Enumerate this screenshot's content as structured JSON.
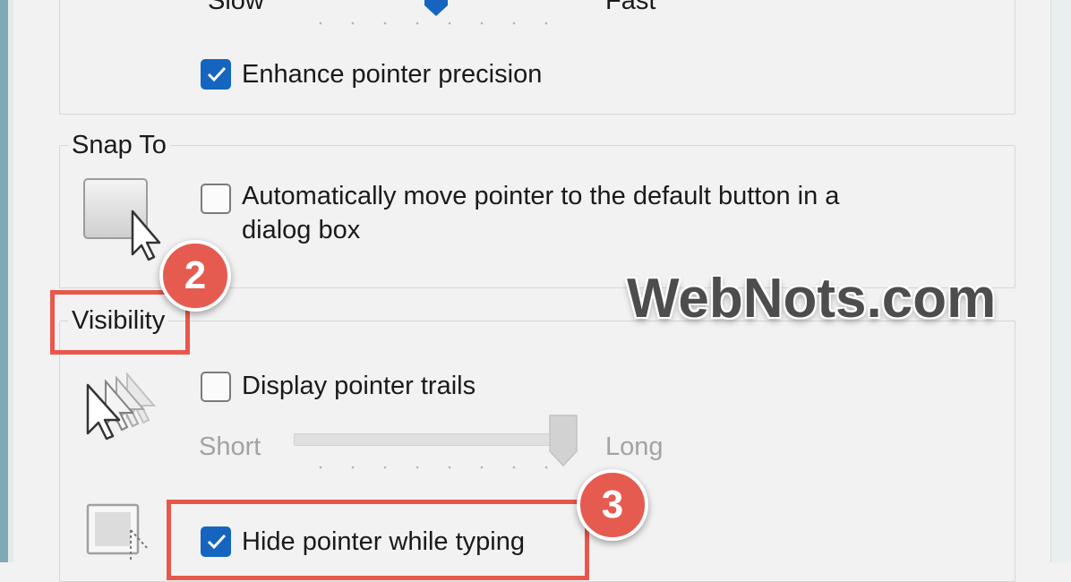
{
  "motion": {
    "slow_label": "Slow",
    "fast_label": "Fast",
    "speed_level_percent": 48,
    "enhance_label": "Enhance pointer precision",
    "enhance_checked": true
  },
  "snap_to": {
    "title": "Snap To",
    "checkbox_label_line1": "Automatically move pointer to the default button in a",
    "checkbox_label_line2": "dialog box",
    "checked": false
  },
  "visibility": {
    "title": "Visibility",
    "trails_label": "Display pointer trails",
    "trails_checked": false,
    "short_label": "Short",
    "long_label": "Long",
    "trail_length_percent": 100,
    "hide_label": "Hide pointer while typing",
    "hide_checked": true
  },
  "annotations": {
    "step2": "2",
    "step3": "3",
    "watermark": "WebNots.com",
    "accent_color": "#e8574c",
    "checkbox_color": "#1565c0"
  }
}
